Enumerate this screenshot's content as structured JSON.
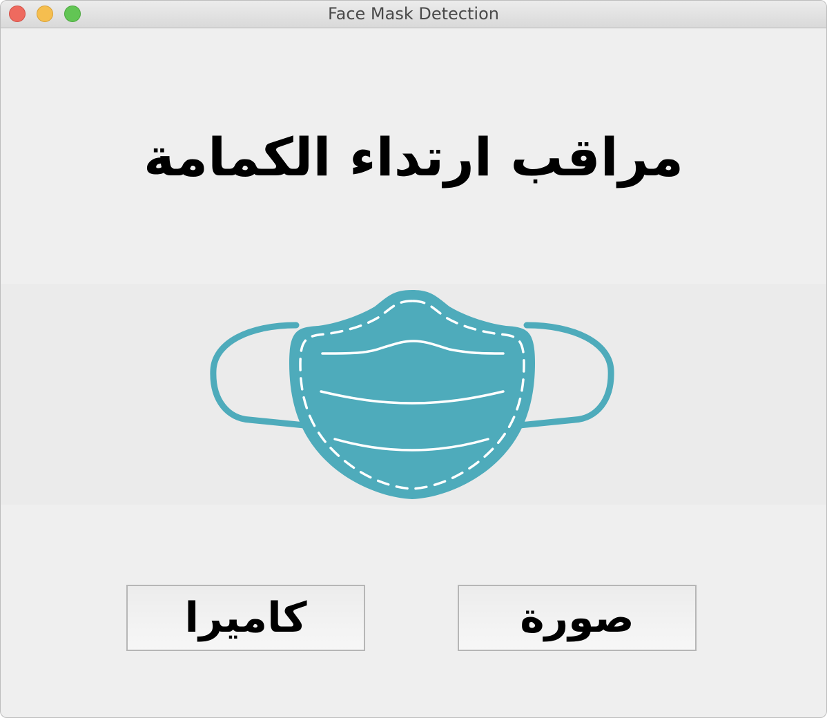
{
  "window": {
    "title": "Face Mask Detection",
    "controls": {
      "close_icon": "traffic-light-red",
      "minimize_icon": "traffic-light-yellow",
      "zoom_icon": "traffic-light-green"
    }
  },
  "main": {
    "heading": "مراقب ارتداء الكمامة",
    "image_icon": "face-mask-icon",
    "mask_color": "#4eabbb"
  },
  "buttons": {
    "camera_label": "كاميرا",
    "photo_label": "صورة"
  }
}
